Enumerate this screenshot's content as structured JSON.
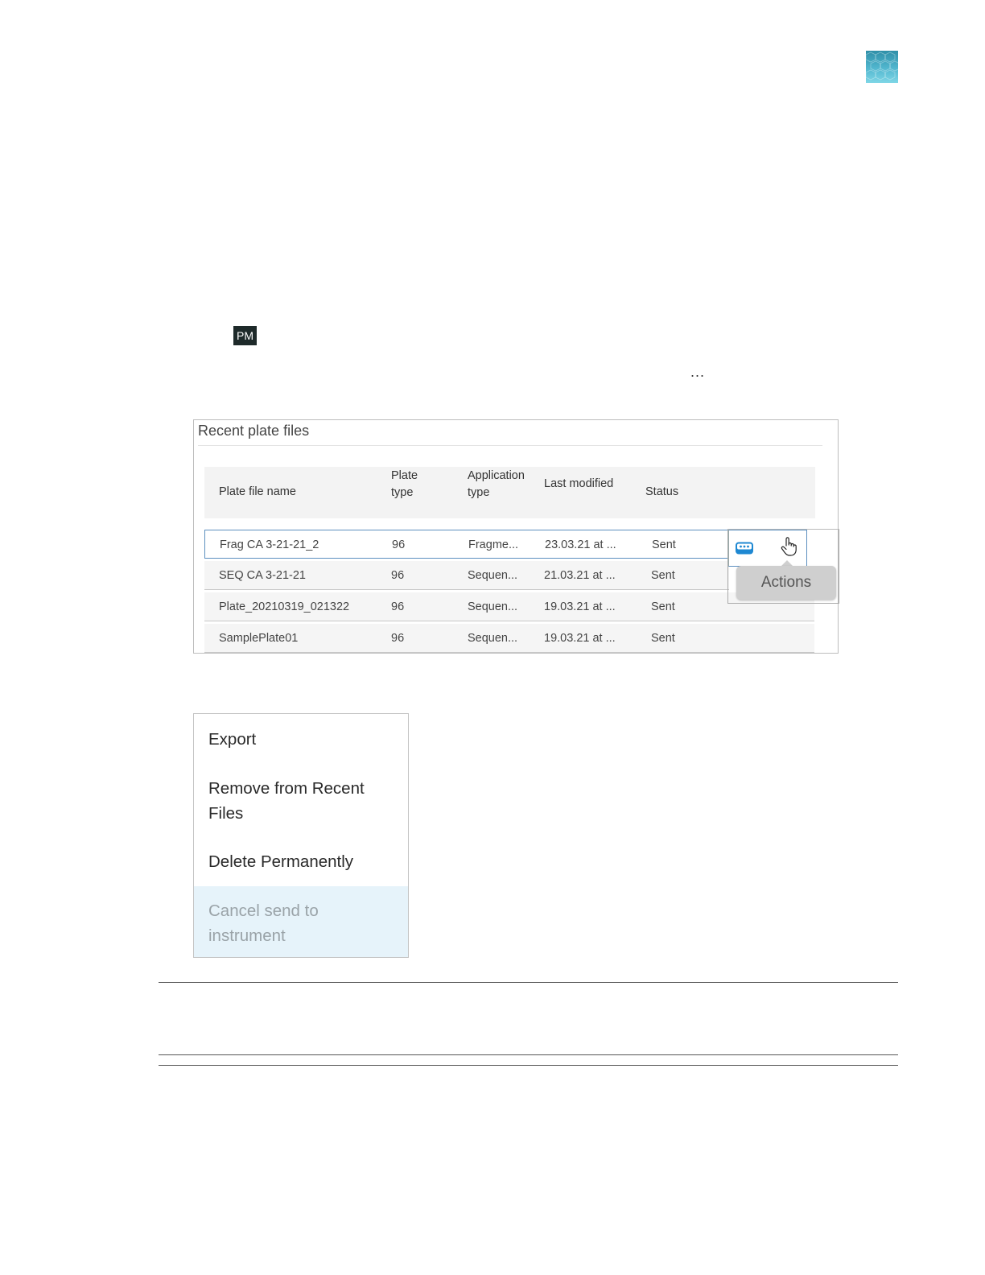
{
  "pm_badge": "PM",
  "ellipsis": "...",
  "panel": {
    "title": "Recent plate files",
    "columns": {
      "name": "Plate file name",
      "plate_type_1": "Plate",
      "plate_type_2": "type",
      "app_type_1": "Application",
      "app_type_2": "type",
      "modified": "Last modified",
      "status": "Status"
    },
    "rows": [
      {
        "name": "Frag CA 3-21-21_2",
        "plate": "96",
        "app": "Fragme...",
        "modified": "23.03.21 at ...",
        "status": "Sent"
      },
      {
        "name": "SEQ CA 3-21-21",
        "plate": "96",
        "app": "Sequen...",
        "modified": "21.03.21 at ...",
        "status": "Sent"
      },
      {
        "name": "Plate_20210319_021322",
        "plate": "96",
        "app": "Sequen...",
        "modified": "19.03.21 at ...",
        "status": "Sent"
      },
      {
        "name": "SamplePlate01",
        "plate": "96",
        "app": "Sequen...",
        "modified": "19.03.21 at ...",
        "status": "Sent"
      }
    ],
    "tooltip": "Actions"
  },
  "menu": {
    "export": "Export",
    "remove_1": "Remove from Recent",
    "remove_2": "Files",
    "delete": "Delete Permanently",
    "cancel_1": "Cancel send to",
    "cancel_2": "instrument"
  },
  "colors": {
    "accent": "#1e88d2",
    "selected_border": "#5c8fbf",
    "disabled_bg": "#e6f3fa"
  }
}
